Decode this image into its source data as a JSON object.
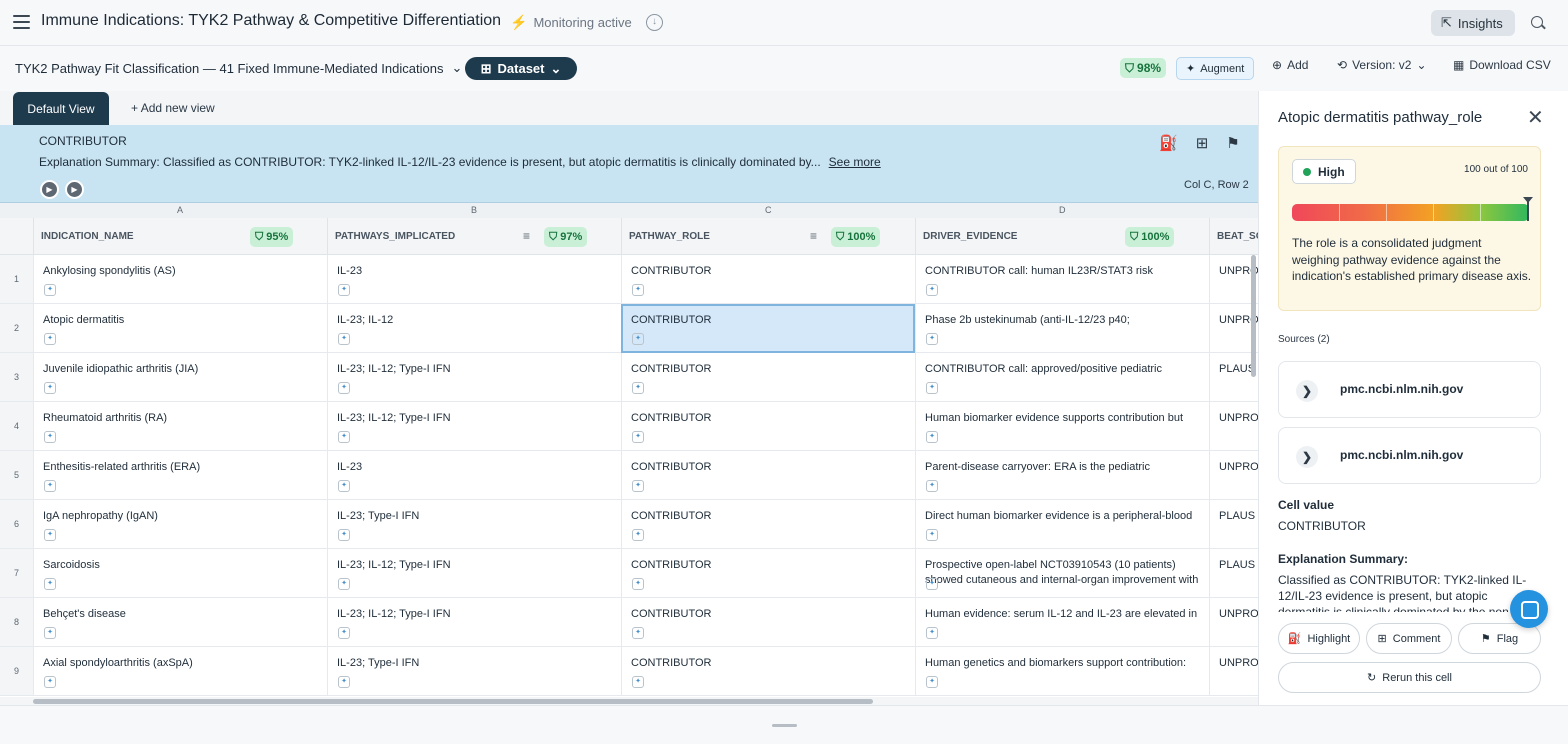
{
  "header": {
    "title": "Immune Indications: TYK2 Pathway & Competitive Differentiation",
    "monitoring": "Monitoring active",
    "insights": "Insights"
  },
  "toolbar": {
    "dataset_title": "TYK2 Pathway Fit Classification — 41 Fixed Immune-Mediated Indications",
    "dataset_button": "Dataset",
    "score": "98%",
    "augment": "Augment",
    "add": "Add",
    "version": "Version: v2",
    "download": "Download CSV"
  },
  "tabs": {
    "default_view": "Default View",
    "add_view": "Add new view"
  },
  "info_panel": {
    "title": "CONTRIBUTOR",
    "explanation": "Explanation Summary: Classified as CONTRIBUTOR: TYK2-linked IL-12/IL-23 evidence is present, but atopic dermatitis is clinically dominated by...",
    "see_more": "See more",
    "location": "Col C, Row 2"
  },
  "columns": [
    {
      "letter": "A",
      "name": "INDICATION_NAME",
      "score": "95%"
    },
    {
      "letter": "B",
      "name": "PATHWAYS_IMPLICATED",
      "score": "97%"
    },
    {
      "letter": "C",
      "name": "PATHWAY_ROLE",
      "score": "100%"
    },
    {
      "letter": "D",
      "name": "DRIVER_EVIDENCE",
      "score": "100%"
    },
    {
      "letter": "",
      "name": "BEAT_SO",
      "score": ""
    }
  ],
  "rows": [
    {
      "n": "1",
      "a": "Ankylosing spondylitis (AS)",
      "b": "IL-23",
      "c": "CONTRIBUTOR",
      "d": "CONTRIBUTOR call: human IL23R/STAT3 risk",
      "e": "UNPRO"
    },
    {
      "n": "2",
      "a": "Atopic dermatitis",
      "b": "IL-23; IL-12",
      "c": "CONTRIBUTOR",
      "d": "Phase 2b ustekinumab (anti-IL-12/23 p40;",
      "e": "UNPRO"
    },
    {
      "n": "3",
      "a": "Juvenile idiopathic arthritis (JIA)",
      "b": "IL-23; IL-12; Type-I IFN",
      "c": "CONTRIBUTOR",
      "d": "CONTRIBUTOR call: approved/positive pediatric",
      "e": "PLAUS"
    },
    {
      "n": "4",
      "a": "Rheumatoid arthritis (RA)",
      "b": "IL-23; IL-12; Type-I IFN",
      "c": "CONTRIBUTOR",
      "d": "Human biomarker evidence supports contribution but",
      "e": "UNPRO"
    },
    {
      "n": "5",
      "a": "Enthesitis-related arthritis (ERA)",
      "b": "IL-23",
      "c": "CONTRIBUTOR",
      "d": "Parent-disease carryover: ERA is the pediatric",
      "e": "UNPRO"
    },
    {
      "n": "6",
      "a": "IgA nephropathy (IgAN)",
      "b": "IL-23; Type-I IFN",
      "c": "CONTRIBUTOR",
      "d": "Direct human biomarker evidence is a peripheral-blood",
      "e": "PLAUS"
    },
    {
      "n": "7",
      "a": "Sarcoidosis",
      "b": "IL-23; IL-12; Type-I IFN",
      "c": "CONTRIBUTOR",
      "d": "Prospective open-label NCT03910543 (10 patients) showed cutaneous and internal-organ improvement with",
      "e": "PLAUS"
    },
    {
      "n": "8",
      "a": "Behçet's disease",
      "b": "IL-23; IL-12; Type-I IFN",
      "c": "CONTRIBUTOR",
      "d": "Human evidence: serum IL-12 and IL-23 are elevated in",
      "e": "UNPRO"
    },
    {
      "n": "9",
      "a": "Axial spondyloarthritis (axSpA)",
      "b": "IL-23; Type-I IFN",
      "c": "CONTRIBUTOR",
      "d": "Human genetics and biomarkers support contribution:",
      "e": "UNPRO"
    }
  ],
  "side_panel": {
    "title": "Atopic dermatitis pathway_role",
    "confidence": "High",
    "score_text": "100 out of 100",
    "score_value": 100,
    "confidence_note": "The role is a consolidated judgment weighing pathway evidence against the indication's established primary disease axis.",
    "sources_label": "Sources (2)",
    "sources": [
      "pmc.ncbi.nlm.nih.gov",
      "pmc.ncbi.nlm.nih.gov"
    ],
    "cell_value_label": "Cell value",
    "cell_value": "CONTRIBUTOR",
    "explanation_label": "Explanation Summary:",
    "explanation": "Classified as CONTRIBUTOR: TYK2-linked IL-12/IL-23 evidence is present, but atopic dermatitis is clinically dominated by the non-",
    "highlight": "Highlight",
    "comment": "Comment",
    "flag": "Flag",
    "rerun": "Rerun this cell"
  },
  "colors": {
    "accent": "#1e3a4d",
    "selected": "#d4e8f9",
    "info_bg": "#c8e3f1",
    "score_green": "#c9f0d6"
  }
}
